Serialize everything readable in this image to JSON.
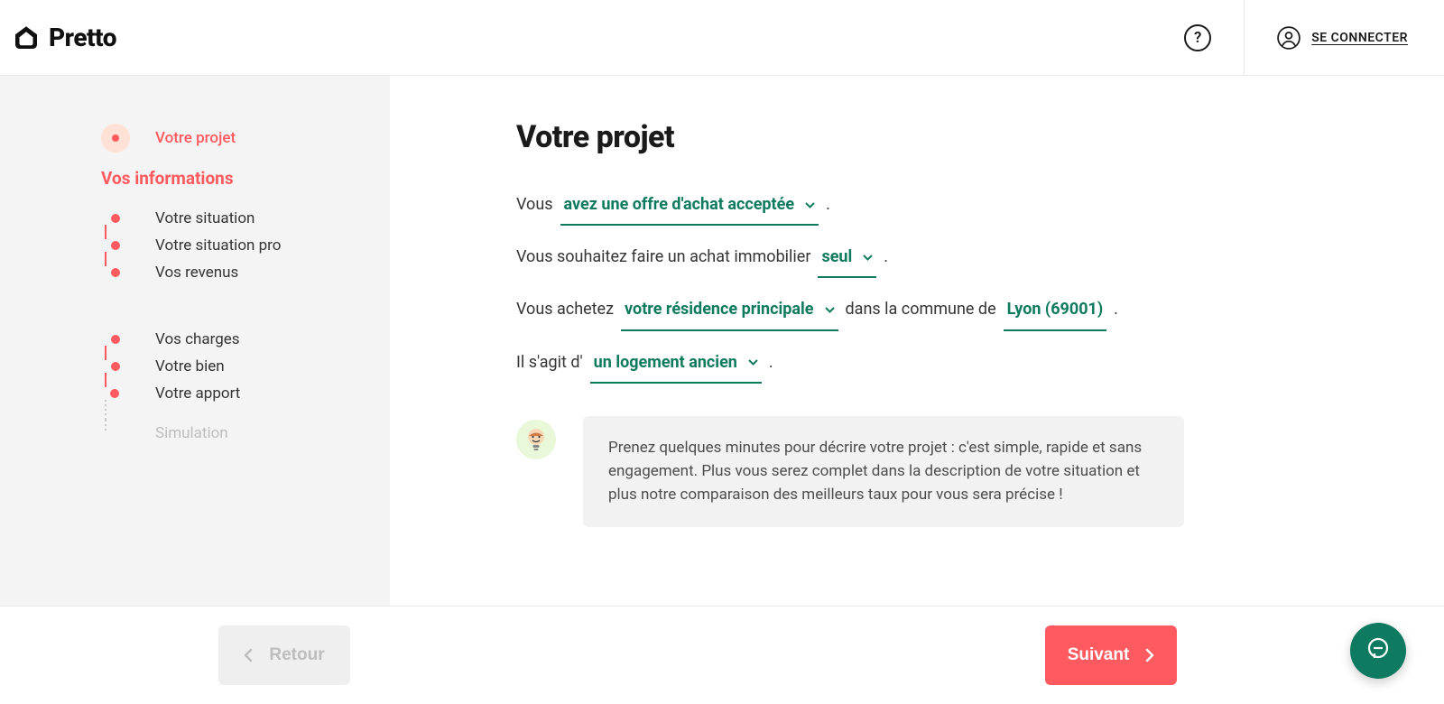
{
  "header": {
    "brand": "Pretto",
    "help_label": "?",
    "signin_label": "SE CONNECTER"
  },
  "sidebar": {
    "current_step": "Votre projet",
    "section_title": "Vos informations",
    "group1": [
      {
        "label": "Votre situation"
      },
      {
        "label": "Votre situation pro"
      },
      {
        "label": "Vos revenus"
      }
    ],
    "group2": [
      {
        "label": "Vos charges"
      },
      {
        "label": "Votre bien"
      },
      {
        "label": "Votre apport"
      }
    ],
    "disabled_step": "Simulation"
  },
  "page": {
    "title": "Votre projet",
    "line1": {
      "pre": "Vous",
      "choice": "avez une offre d'achat acceptée",
      "post": "."
    },
    "line2": {
      "pre": "Vous souhaitez faire un achat immobilier",
      "choice": "seul",
      "post": "."
    },
    "line3": {
      "pre": "Vous achetez",
      "choice1": "votre résidence principale",
      "mid": "dans la commune de",
      "choice2": "Lyon (69001)",
      "post": "."
    },
    "line4": {
      "pre": "Il s'agit d'",
      "choice": "un logement ancien",
      "post": "."
    },
    "tip_text": "Prenez quelques minutes pour décrire votre projet : c'est simple, rapide et sans engagement. Plus vous serez complet dans la description de votre situation et plus notre comparaison des meilleurs taux pour vous sera précise !"
  },
  "footer": {
    "back_label": "Retour",
    "next_label": "Suivant"
  }
}
